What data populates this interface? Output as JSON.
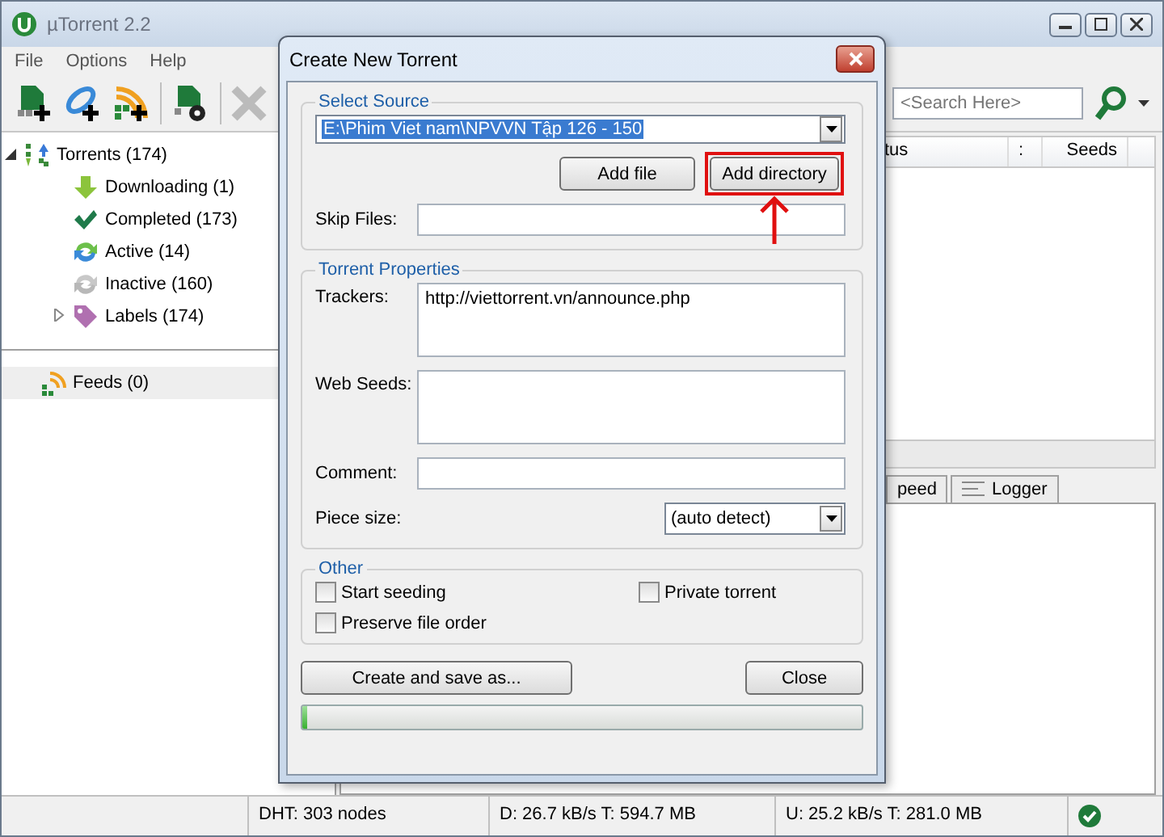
{
  "window": {
    "title": "µTorrent 2.2"
  },
  "menu": [
    "File",
    "Options",
    "Help"
  ],
  "search": {
    "placeholder": "<Search Here>"
  },
  "sidebar": {
    "tree": [
      {
        "label": "Torrents (174)",
        "expanded": true,
        "children": [
          {
            "label": "Downloading (1)"
          },
          {
            "label": "Completed (173)"
          },
          {
            "label": "Active (14)"
          },
          {
            "label": "Inactive (160)"
          },
          {
            "label": "Labels (174)",
            "expanded": false
          }
        ]
      }
    ],
    "feeds": {
      "label": "Feeds (0)",
      "selected": true
    }
  },
  "table": {
    "columns": [
      "tus",
      ":",
      "Seeds"
    ]
  },
  "bottom_tabs": [
    "peed",
    "Logger"
  ],
  "status_bar": [
    "DHT: 303 nodes",
    "D: 26.7 kB/s T: 594.7 MB",
    "U: 25.2 kB/s T: 281.0 MB"
  ],
  "dialog": {
    "title": "Create New Torrent",
    "source": {
      "legend": "Select Source",
      "path": "E:\\Phim Viet nam\\NPVVN Tập 126 - 150",
      "buttons": [
        "Add file",
        "Add directory"
      ],
      "skip_label": "Skip Files:"
    },
    "properties": {
      "legend": "Torrent Properties",
      "trackers_label": "Trackers:",
      "trackers": "http://viettorrent.vn/announce.php",
      "web_seeds_label": "Web Seeds:",
      "comment_label": "Comment:",
      "piece_label": "Piece size:",
      "piece_value": "(auto detect)"
    },
    "other": {
      "legend": "Other",
      "options": [
        {
          "label": "Start seeding",
          "checked": false
        },
        {
          "label": "Private torrent",
          "checked": false
        },
        {
          "label": "Preserve file order",
          "checked": false
        }
      ]
    },
    "buttons": [
      "Create and save as...",
      "Close"
    ],
    "progress": {
      "level": 0.01
    }
  }
}
